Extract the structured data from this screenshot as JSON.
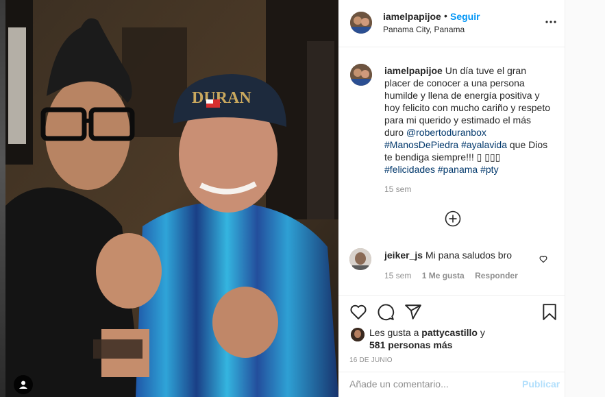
{
  "post": {
    "username": "iamelpapijoe",
    "separator": "•",
    "follow_label": "Seguir",
    "location": "Panama City, Panama",
    "more_icon": "more-options-icon"
  },
  "caption": {
    "username": "iamelpapijoe",
    "text_1": "Un día tuve el gran placer de conocer a una persona humilde y llena de energía positiva y hoy felicito con mucho cariño y respeto para mi querido y estimado el más duro",
    "mention": "@robertoduranbox",
    "tag_1": "#ManosDePiedra",
    "tag_2": "#ayalavida",
    "text_2": "que Dios te bendiga siempre!!!",
    "emoji": "▯ ▯▯▯",
    "tag_3": "#felicidades",
    "tag_4": "#panama",
    "tag_5": "#pty",
    "time": "15 sem"
  },
  "comment": {
    "username": "jeiker_js",
    "text": "Mi pana saludos bro",
    "time": "15 sem",
    "likes": "1 Me gusta",
    "reply": "Responder"
  },
  "likes": {
    "prefix": "Les gusta a",
    "user": "pattycastillo",
    "and": "y",
    "others": "581 personas más"
  },
  "date": "16 DE JUNIO",
  "comment_box": {
    "placeholder": "Añade un comentario...",
    "publish_label": "Publicar"
  },
  "photo": {
    "cap_text": "DURAN"
  }
}
